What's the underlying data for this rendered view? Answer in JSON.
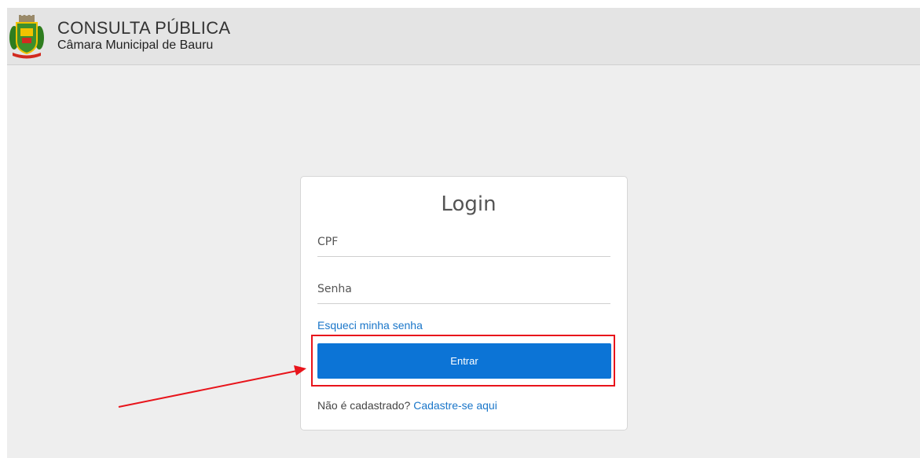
{
  "header": {
    "title": "CONSULTA PÚBLICA",
    "subtitle": "Câmara Municipal de Bauru",
    "logo_icon": "municipal-crest-icon"
  },
  "login": {
    "title": "Login",
    "cpf_placeholder": "CPF",
    "senha_placeholder": "Senha",
    "forgot_link": "Esqueci minha senha",
    "enter_button": "Entrar",
    "register_prompt": "Não é cadastrado?",
    "register_link": "Cadastre-se aqui"
  },
  "annotations": {
    "highlight_color": "#e8141b",
    "arrow_icon": "red-arrow-icon"
  },
  "colors": {
    "accent": "#0c74d6",
    "link": "#1a76c9",
    "background": "#eeeeee",
    "header_background": "#e4e4e4"
  }
}
